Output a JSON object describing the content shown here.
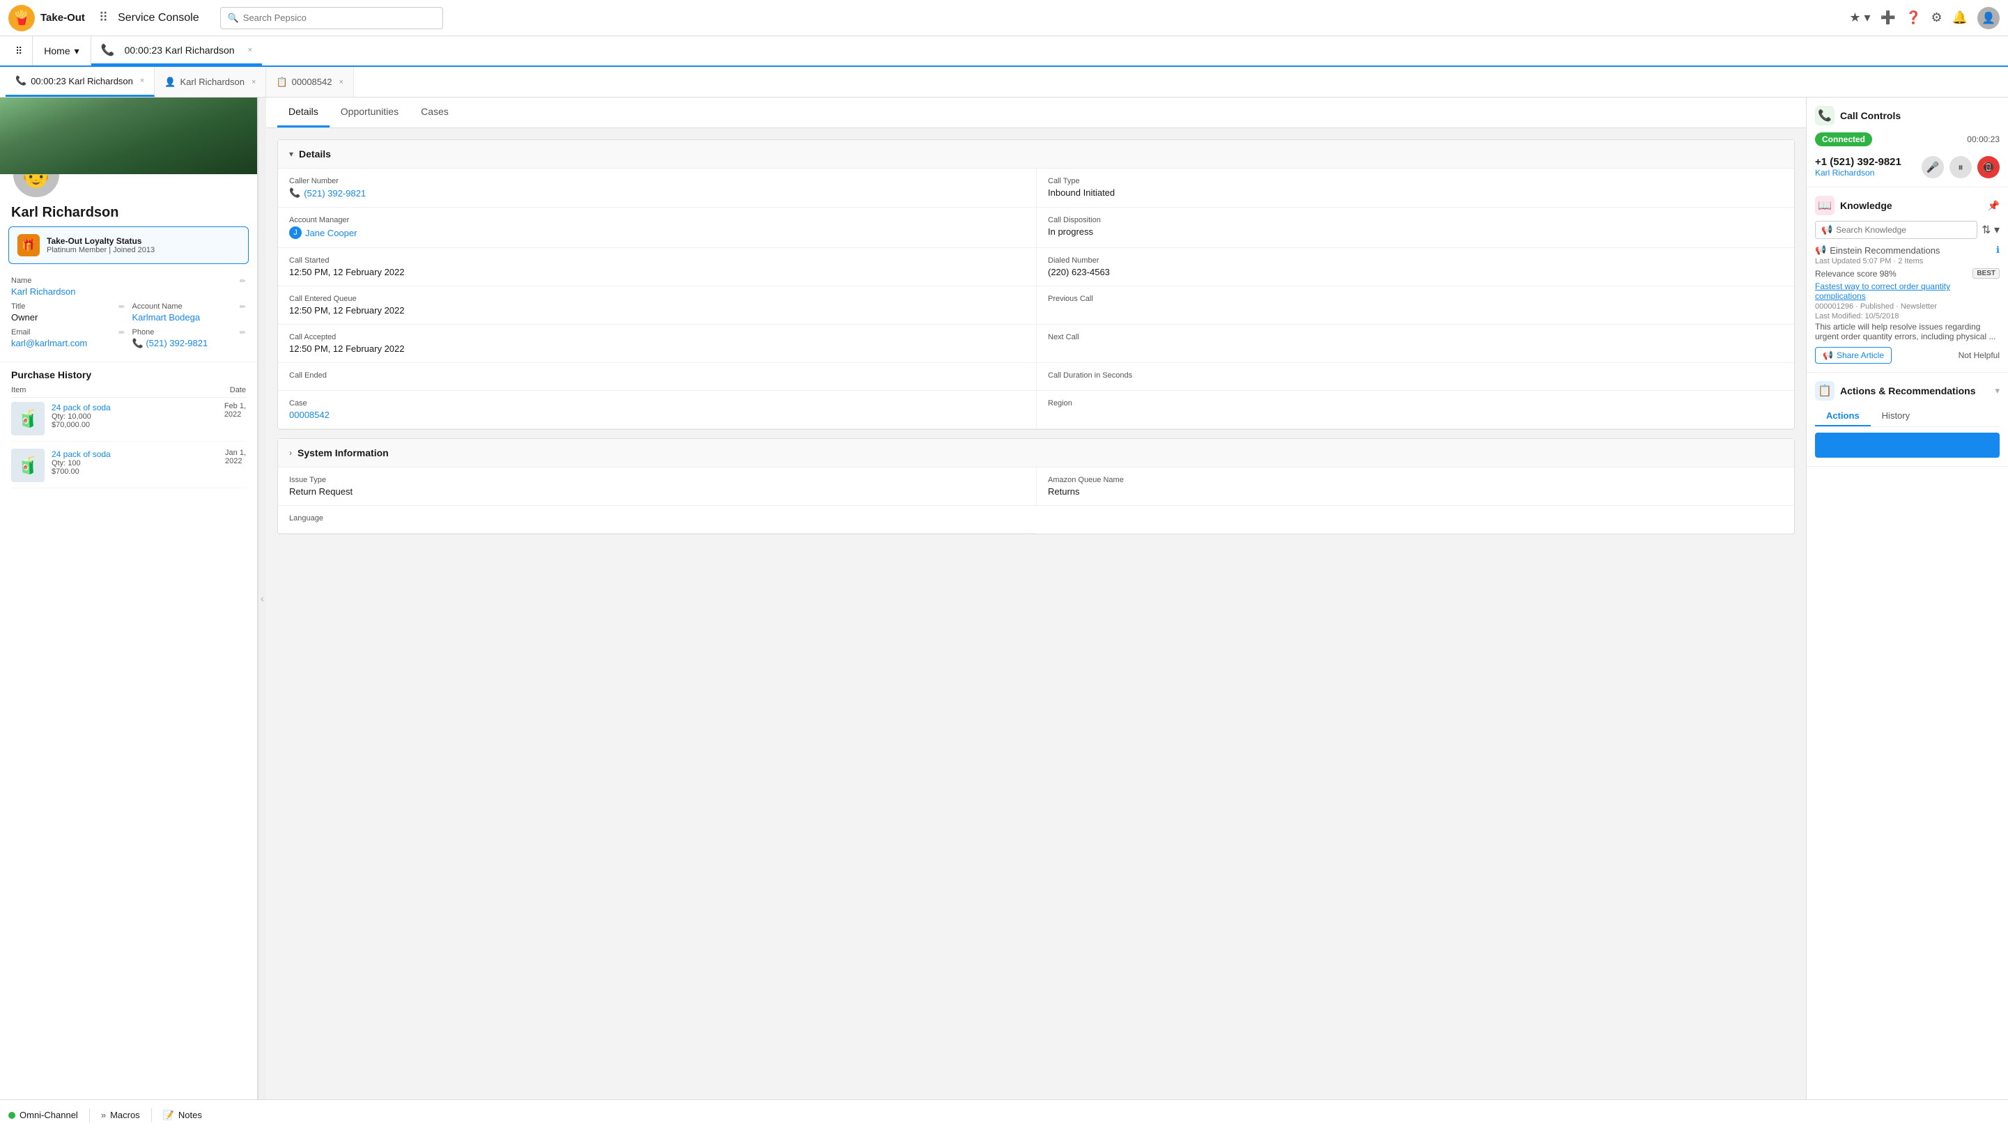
{
  "app": {
    "logo_emoji": "🍟",
    "name": "Take-Out",
    "app_title": "Service Console"
  },
  "top_nav": {
    "search_placeholder": "Search Pepsico",
    "star_label": "★",
    "add_label": "+",
    "help_label": "?",
    "settings_label": "⚙",
    "bell_label": "🔔"
  },
  "utility_nav": {
    "home_label": "Home",
    "home_chevron": "▾",
    "call_tab_label": "00:00:23 Karl Richardson",
    "call_tab_close": "×"
  },
  "inner_tabs": [
    {
      "label": "00:00:23 Karl Richardson",
      "icon": "📞",
      "active": true,
      "closeable": true
    },
    {
      "label": "Karl Richardson",
      "icon": "👤",
      "active": false,
      "closeable": true
    },
    {
      "label": "00008542",
      "icon": "📋",
      "active": false,
      "closeable": true
    }
  ],
  "sidebar": {
    "person_name": "Karl Richardson",
    "loyalty": {
      "title": "Take-Out Loyalty Status",
      "subtitle": "Platinum Member | Joined 2013"
    },
    "fields": {
      "name_label": "Name",
      "name_value": "Karl Richardson",
      "title_label": "Title",
      "title_value": "Owner",
      "account_label": "Account Name",
      "account_value": "Karlmart Bodega",
      "email_label": "Email",
      "email_value": "karl@karlmart.com",
      "phone_label": "Phone",
      "phone_value": "(521) 392-9821"
    },
    "purchase_history": {
      "title": "Purchase History",
      "col_item": "Item",
      "col_date": "Date",
      "items": [
        {
          "name": "24 pack of soda",
          "qty": "Qty: 10,000",
          "price": "$70,000.00",
          "date": "Feb 1, 2022"
        },
        {
          "name": "24 pack of soda",
          "qty": "Qty: 100",
          "price": "$700.00",
          "date": "Jan 1, 2022"
        }
      ]
    }
  },
  "content": {
    "tabs": [
      "Details",
      "Opportunities",
      "Cases"
    ],
    "active_tab": "Details",
    "details_section": {
      "title": "Details",
      "fields": [
        {
          "label": "Caller Number",
          "value": "(521) 392-9821",
          "type": "phone"
        },
        {
          "label": "Call Type",
          "value": "Inbound Initiated",
          "type": "text"
        },
        {
          "label": "Account Manager",
          "value": "Jane Cooper",
          "type": "person"
        },
        {
          "label": "Call Disposition",
          "value": "In progress",
          "type": "text"
        },
        {
          "label": "Call Started",
          "value": "12:50 PM, 12 February 2022",
          "type": "text"
        },
        {
          "label": "Dialed Number",
          "value": "(220) 623-4563",
          "type": "text"
        },
        {
          "label": "Call Entered Queue",
          "value": "12:50 PM, 12 February 2022",
          "type": "text"
        },
        {
          "label": "Previous Call",
          "value": "",
          "type": "text"
        },
        {
          "label": "Call Accepted",
          "value": "12:50 PM, 12 February 2022",
          "type": "text"
        },
        {
          "label": "Next Call",
          "value": "",
          "type": "text"
        },
        {
          "label": "Call Ended",
          "value": "",
          "type": "text"
        },
        {
          "label": "Call Duration in Seconds",
          "value": "",
          "type": "text"
        },
        {
          "label": "Case",
          "value": "00008542",
          "type": "link"
        },
        {
          "label": "Region",
          "value": "",
          "type": "text"
        }
      ]
    },
    "system_section": {
      "title": "System Information",
      "fields": [
        {
          "label": "Issue Type",
          "value": "Return Request",
          "type": "text"
        },
        {
          "label": "Amazon Queue Name",
          "value": "Returns",
          "type": "text"
        },
        {
          "label": "Language",
          "value": "",
          "type": "text"
        }
      ]
    }
  },
  "right_panel": {
    "call_controls": {
      "title": "Call Controls",
      "status": "Connected",
      "timer": "00:00:23",
      "phone_number": "+1 (521) 392-9821",
      "person_name": "Karl Richardson",
      "mute_icon": "🎤",
      "hold_icon": "⏸",
      "end_icon": "📵"
    },
    "knowledge": {
      "title": "Knowledge",
      "search_placeholder": "Search Knowledge",
      "einstein_label": "Einstein Recommendations",
      "last_updated": "Last Updated 5:07 PM · 2 Items",
      "relevance_label": "Relevance score 98%",
      "relevance_badge": "BEST",
      "article": {
        "title": "Fastest way to correct order quantity complications",
        "meta": "000001296 · Published · Newsletter",
        "last_modified": "Last Modified: 10/5/2018",
        "description": "This article will help resolve issues regarding urgent order quantity errors, including physical ..."
      },
      "share_label": "Share Article",
      "not_helpful_label": "Not Helpful"
    },
    "actions_recommendations": {
      "title": "Actions & Recommendations",
      "tabs": [
        "Actions",
        "History"
      ],
      "active_tab": "Actions"
    }
  },
  "bottom_bar": {
    "omnichannel_label": "Omni-Channel",
    "macros_label": "Macros",
    "notes_label": "Notes"
  }
}
